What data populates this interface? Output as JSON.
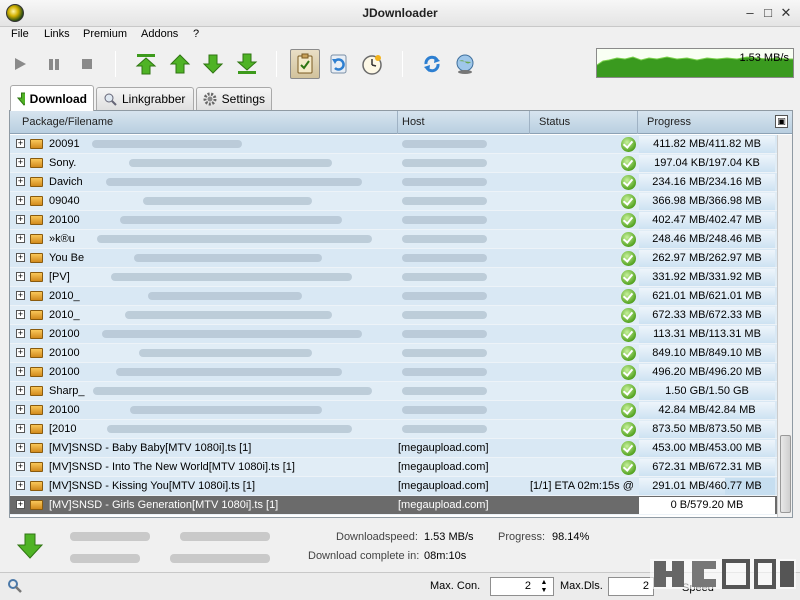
{
  "window": {
    "title": "JDownloader"
  },
  "menu": [
    "File",
    "Links",
    "Premium",
    "Addons",
    "?"
  ],
  "toolbar": {
    "buttons": [
      "play-icon",
      "pause-icon",
      "stop-icon",
      "move-top-icon",
      "move-up-icon",
      "move-down-icon",
      "move-bottom-icon",
      "clipboard-icon",
      "reconnect-icon",
      "clock-icon",
      "refresh-icon",
      "update-globe-icon"
    ],
    "speed_graph_label": "1.53 MB/s"
  },
  "tabs": [
    {
      "label": "Download"
    },
    {
      "label": "Linkgrabber"
    },
    {
      "label": "Settings"
    }
  ],
  "table": {
    "columns": [
      "Package/Filename",
      "Host",
      "Status",
      "Progress"
    ],
    "rows": [
      {
        "name": "20091",
        "host": "",
        "status": "",
        "progress": "411.82 MB/411.82 MB",
        "done": true
      },
      {
        "name": "Sony.",
        "host": "",
        "status": "",
        "progress": "197.04 KB/197.04 KB",
        "done": true
      },
      {
        "name": "Davich",
        "host": "",
        "status": "",
        "progress": "234.16 MB/234.16 MB",
        "done": true
      },
      {
        "name": "09040",
        "host": "",
        "status": "",
        "progress": "366.98 MB/366.98 MB",
        "done": true
      },
      {
        "name": "20100",
        "host": "",
        "status": "",
        "progress": "402.47 MB/402.47 MB",
        "done": true
      },
      {
        "name": "»k®u",
        "host": "",
        "status": "",
        "progress": "248.46 MB/248.46 MB",
        "done": true
      },
      {
        "name": "You Be",
        "host": "",
        "status": "",
        "progress": "262.97 MB/262.97 MB",
        "done": true
      },
      {
        "name": "[PV]",
        "host": "",
        "status": "",
        "progress": "331.92 MB/331.92 MB",
        "done": true
      },
      {
        "name": "2010_",
        "host": "",
        "status": "",
        "progress": "621.01 MB/621.01 MB",
        "done": true
      },
      {
        "name": "2010_",
        "host": "",
        "status": "",
        "progress": "672.33 MB/672.33 MB",
        "done": true
      },
      {
        "name": "20100",
        "host": "",
        "status": "",
        "progress": "113.31 MB/113.31 MB",
        "done": true
      },
      {
        "name": "20100",
        "host": "",
        "status": "",
        "progress": "849.10 MB/849.10 MB",
        "done": true
      },
      {
        "name": "20100",
        "host": "",
        "status": "",
        "progress": "496.20 MB/496.20 MB",
        "done": true
      },
      {
        "name": "Sharp_",
        "host": "",
        "status": "",
        "progress": "1.50 GB/1.50 GB",
        "done": true
      },
      {
        "name": "20100",
        "host": "",
        "status": "",
        "progress": "42.84 MB/42.84 MB",
        "done": true
      },
      {
        "name": "[2010",
        "host": "",
        "status": "",
        "progress": "873.50 MB/873.50 MB",
        "done": true
      },
      {
        "name": "[MV]SNSD - Baby Baby[MTV 1080i].ts [1]",
        "host": "[megaupload.com]",
        "status": "",
        "progress": "453.00 MB/453.00 MB",
        "done": true
      },
      {
        "name": "[MV]SNSD - Into The New World[MTV 1080i].ts [1]",
        "host": "[megaupload.com]",
        "status": "",
        "progress": "672.31 MB/672.31 MB",
        "done": true
      },
      {
        "name": "[MV]SNSD - Kissing You[MTV 1080i].ts [1]",
        "host": "[megaupload.com]",
        "status": "[1/1] ETA 02m:15s @",
        "progress": "291.01 MB/460.77 MB",
        "done": false,
        "fraction": 0.63
      },
      {
        "name": "[MV]SNSD - Girls Generation[MTV 1080i].ts [1]",
        "host": "[megaupload.com]",
        "status": "",
        "progress": "0 B/579.20 MB",
        "done": false,
        "fraction": 0,
        "selected": true
      }
    ]
  },
  "stats": {
    "download_speed_label": "Downloadspeed:",
    "download_speed_value": "1.53 MB/s",
    "progress_label": "Progress:",
    "progress_value": "98.14%",
    "complete_in_label": "Download complete in:",
    "complete_in_value": "08m:10s"
  },
  "statusbar": {
    "max_con_label": "Max. Con.",
    "max_con_value": "2",
    "max_dls_label": "Max.Dls.",
    "max_dls_value": "2",
    "speed_label": "Speed"
  },
  "colors": {
    "row_bg": "#d9e8f4",
    "selected_row": "#6b6b6b",
    "graph_green": "#3a9a1f",
    "check_green": "#55a421"
  }
}
